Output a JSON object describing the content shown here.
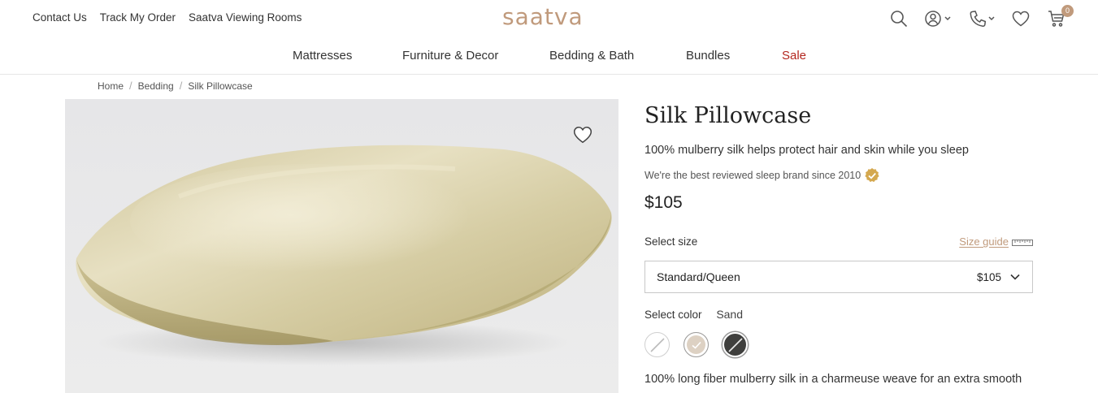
{
  "header": {
    "utility_links": [
      "Contact Us",
      "Track My Order",
      "Saatva Viewing Rooms"
    ],
    "logo": "saatva",
    "icons": [
      "search-icon",
      "account-icon",
      "phone-icon",
      "heart-icon",
      "cart-icon"
    ],
    "cart_count": "0"
  },
  "nav": {
    "items": [
      "Mattresses",
      "Furniture & Decor",
      "Bedding & Bath",
      "Bundles",
      "Sale"
    ]
  },
  "breadcrumb": [
    "Home",
    "Bedding",
    "Silk Pillowcase"
  ],
  "product": {
    "title": "Silk Pillowcase",
    "subtitle": "100% mulberry silk helps protect hair and skin while you sleep",
    "reviewed": "We're the best reviewed sleep brand since 2010",
    "price": "$105",
    "size_label": "Select size",
    "size_guide": "Size guide",
    "size_selected": "Standard/Queen",
    "size_price": "$105",
    "color_label": "Select color",
    "color_selected": "Sand",
    "swatches": [
      {
        "name": "white",
        "color": "#ffffff",
        "available": false
      },
      {
        "name": "sand",
        "color": "#ddd1c3",
        "selected": true
      },
      {
        "name": "charcoal",
        "color": "#3f3f3d",
        "available": false
      }
    ],
    "description": "100% long fiber mulberry silk in a charmeuse weave for an extra smooth"
  },
  "colors": {
    "brand": "#c09a7c",
    "sale": "#b3261e",
    "badge": "#d4a84f"
  }
}
